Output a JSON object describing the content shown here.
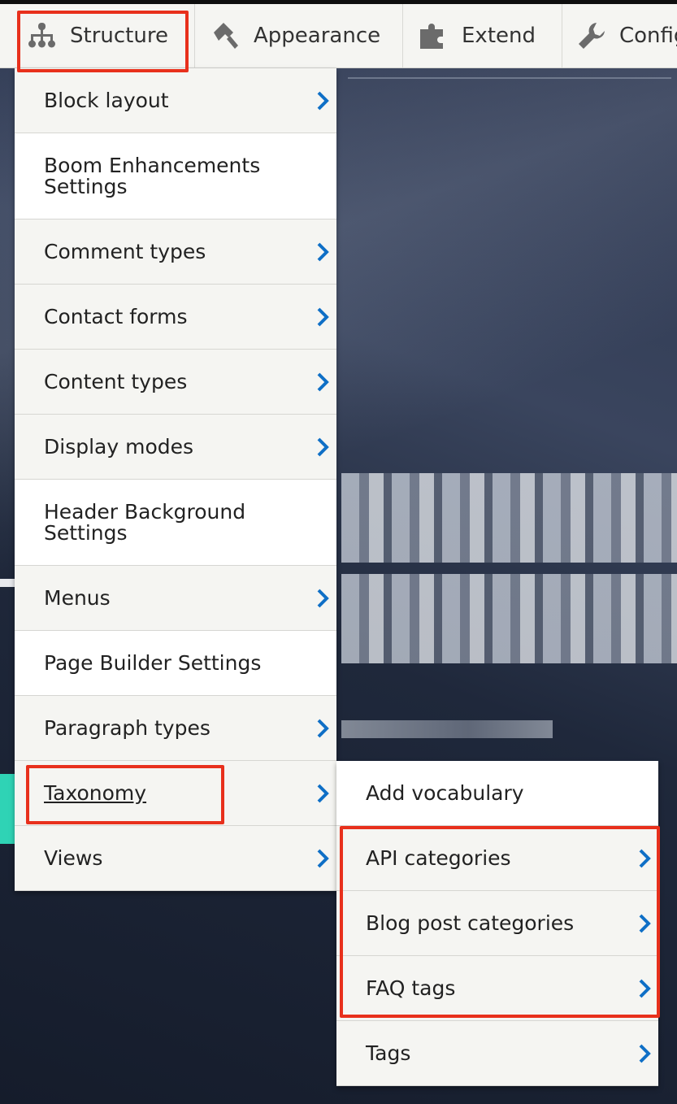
{
  "toolbar": {
    "items": [
      {
        "label": "Structure",
        "icon": "sitemap-icon"
      },
      {
        "label": "Appearance",
        "icon": "paintbrush-icon"
      },
      {
        "label": "Extend",
        "icon": "puzzle-icon"
      },
      {
        "label": "Config",
        "icon": "wrench-icon"
      }
    ]
  },
  "structure_menu": {
    "items": [
      {
        "label": "Block layout",
        "has_submenu": true
      },
      {
        "label": "Boom Enhancements Settings",
        "has_submenu": false
      },
      {
        "label": "Comment types",
        "has_submenu": true
      },
      {
        "label": "Contact forms",
        "has_submenu": true
      },
      {
        "label": "Content types",
        "has_submenu": true
      },
      {
        "label": "Display modes",
        "has_submenu": true
      },
      {
        "label": "Header Background Settings",
        "has_submenu": false
      },
      {
        "label": "Menus",
        "has_submenu": true
      },
      {
        "label": "Page Builder Settings",
        "has_submenu": false
      },
      {
        "label": "Paragraph types",
        "has_submenu": true
      },
      {
        "label": "Taxonomy",
        "has_submenu": true
      },
      {
        "label": "Views",
        "has_submenu": true
      }
    ]
  },
  "taxonomy_submenu": {
    "items": [
      {
        "label": "Add vocabulary",
        "has_submenu": false
      },
      {
        "label": "API categories",
        "has_submenu": true
      },
      {
        "label": "Blog post categories",
        "has_submenu": true
      },
      {
        "label": "FAQ tags",
        "has_submenu": true
      },
      {
        "label": "Tags",
        "has_submenu": true
      }
    ]
  },
  "colors": {
    "accent_chevron": "#0f6fc6",
    "highlight": "#e8301c",
    "menu_bg": "#f5f5f2"
  }
}
